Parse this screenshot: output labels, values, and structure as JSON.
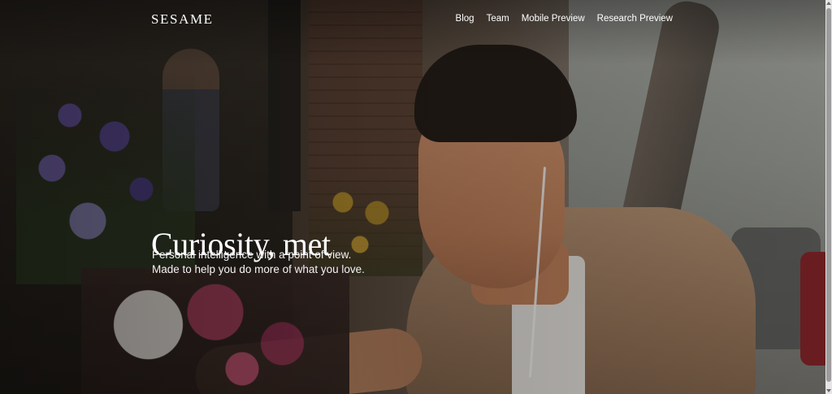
{
  "header": {
    "logo": "SESAME",
    "nav": [
      {
        "label": "Blog"
      },
      {
        "label": "Team"
      },
      {
        "label": "Mobile Preview"
      },
      {
        "label": "Research Preview"
      }
    ]
  },
  "hero": {
    "title": "Curiosity, met",
    "subtitle_lines": [
      "Personal intelligence with a point of view.",
      "Made to help you do more of what you love."
    ]
  },
  "colors": {
    "text": "#ffffff",
    "overlay": "#000000"
  }
}
